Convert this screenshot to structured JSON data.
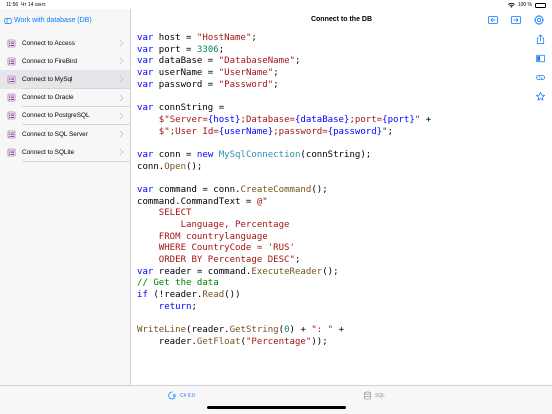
{
  "status": {
    "time": "11:56",
    "date": "Чт 14 сент.",
    "battery": "100 %"
  },
  "sidebar": {
    "back_label": "Work with database (DB)",
    "items": [
      {
        "label": "Connect to Access",
        "selected": false
      },
      {
        "label": "Connect to FireBird",
        "selected": false
      },
      {
        "label": "Connect to MySql",
        "selected": true
      },
      {
        "label": "Connect to Oracle",
        "selected": false
      },
      {
        "label": "Connect to PostgreSQL",
        "selected": false
      },
      {
        "label": "Connect to SQL Server",
        "selected": false
      },
      {
        "label": "Connect to SQLite",
        "selected": false
      }
    ]
  },
  "nav": {
    "title": "Connect to the DB"
  },
  "code_lines": [
    [
      [
        "kw",
        "var"
      ],
      [
        "p",
        " host = "
      ],
      [
        "str",
        "\"HostName\""
      ],
      [
        "p",
        ";"
      ]
    ],
    [
      [
        "kw",
        "var"
      ],
      [
        "p",
        " port = "
      ],
      [
        "num",
        "3306"
      ],
      [
        "p",
        ";"
      ]
    ],
    [
      [
        "kw",
        "var"
      ],
      [
        "p",
        " dataBase = "
      ],
      [
        "str",
        "\"DatabaseName\""
      ],
      [
        "p",
        ";"
      ]
    ],
    [
      [
        "kw",
        "var"
      ],
      [
        "p",
        " userName = "
      ],
      [
        "str",
        "\"UserName\""
      ],
      [
        "p",
        ";"
      ]
    ],
    [
      [
        "kw",
        "var"
      ],
      [
        "p",
        " password = "
      ],
      [
        "str",
        "\"Password\""
      ],
      [
        "p",
        ";"
      ]
    ],
    [],
    [
      [
        "kw",
        "var"
      ],
      [
        "p",
        " connString ="
      ]
    ],
    [
      [
        "p",
        "    "
      ],
      [
        "str",
        "$\"Server="
      ],
      [
        "var",
        "{host}"
      ],
      [
        "str",
        ";Database="
      ],
      [
        "var",
        "{dataBase}"
      ],
      [
        "str",
        ";port="
      ],
      [
        "var",
        "{port}"
      ],
      [
        "str",
        "\""
      ],
      [
        "p",
        " +"
      ]
    ],
    [
      [
        "p",
        "    "
      ],
      [
        "str",
        "$\";User Id="
      ],
      [
        "var",
        "{userName}"
      ],
      [
        "str",
        ";password="
      ],
      [
        "var",
        "{password}"
      ],
      [
        "str",
        "\""
      ],
      [
        "p",
        ";"
      ]
    ],
    [],
    [
      [
        "kw",
        "var"
      ],
      [
        "p",
        " conn = "
      ],
      [
        "kw",
        "new"
      ],
      [
        "p",
        " "
      ],
      [
        "cls",
        "MySqlConnection"
      ],
      [
        "p",
        "(connString);"
      ]
    ],
    [
      [
        "p",
        "conn."
      ],
      [
        "fn",
        "Open"
      ],
      [
        "p",
        "();"
      ]
    ],
    [],
    [
      [
        "kw",
        "var"
      ],
      [
        "p",
        " command = conn."
      ],
      [
        "fn",
        "CreateCommand"
      ],
      [
        "p",
        "();"
      ]
    ],
    [
      [
        "p",
        "command.CommandText = "
      ],
      [
        "str",
        "@\""
      ]
    ],
    [
      [
        "str",
        "    SELECT"
      ]
    ],
    [
      [
        "str",
        "        Language, Percentage"
      ]
    ],
    [
      [
        "str",
        "    FROM countrylanguage"
      ]
    ],
    [
      [
        "str",
        "    WHERE CountryCode = 'RUS'"
      ]
    ],
    [
      [
        "str",
        "    ORDER BY Percentage DESC\""
      ],
      [
        "p",
        ";"
      ]
    ],
    [
      [
        "kw",
        "var"
      ],
      [
        "p",
        " reader = command."
      ],
      [
        "fn",
        "ExecuteReader"
      ],
      [
        "p",
        "();"
      ]
    ],
    [
      [
        "cm",
        "// Get the data"
      ]
    ],
    [
      [
        "kw",
        "if"
      ],
      [
        "p",
        " (!reader."
      ],
      [
        "fn",
        "Read"
      ],
      [
        "p",
        "())"
      ]
    ],
    [
      [
        "p",
        "    "
      ],
      [
        "kw",
        "return"
      ],
      [
        "p",
        ";"
      ]
    ],
    [],
    [
      [
        "fn",
        "WriteLine"
      ],
      [
        "p",
        "(reader."
      ],
      [
        "fn",
        "GetString"
      ],
      [
        "p",
        "("
      ],
      [
        "num",
        "0"
      ],
      [
        "p",
        ") + "
      ],
      [
        "str",
        "\": \""
      ],
      [
        "p",
        " +"
      ]
    ],
    [
      [
        "p",
        "    reader."
      ],
      [
        "fn",
        "GetFloat"
      ],
      [
        "p",
        "("
      ],
      [
        "str",
        "\"Percentage\""
      ],
      [
        "p",
        "));"
      ]
    ]
  ],
  "tabs": [
    {
      "label": "C# 9.0",
      "active": true,
      "icon": "csharp-icon"
    },
    {
      "label": "SQL",
      "active": false,
      "icon": "database-icon"
    }
  ],
  "colors": {
    "accent": "#0a7aff",
    "keyword": "#0000ff",
    "string": "#a31515",
    "method": "#74531f",
    "type": "#2b91af",
    "comment": "#008000",
    "number": "#098658"
  }
}
